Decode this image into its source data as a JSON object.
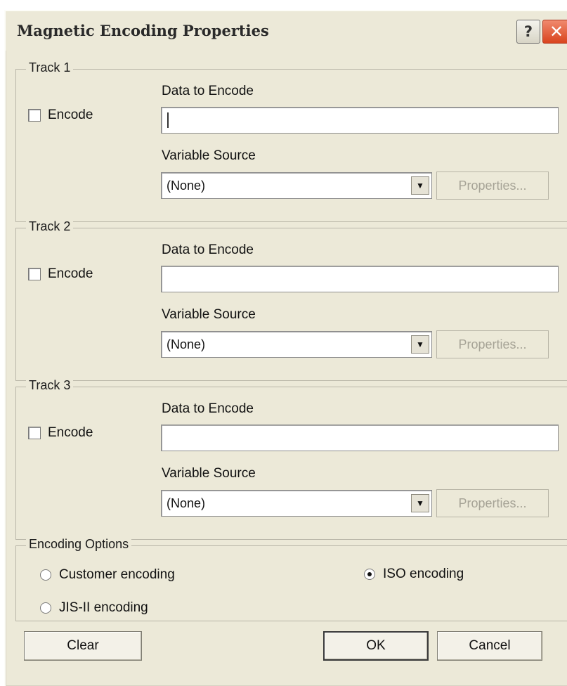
{
  "window": {
    "title": "Magnetic Encoding Properties",
    "help_glyph": "?",
    "close_glyph": "✕"
  },
  "tracks": [
    {
      "legend": "Track 1",
      "encode_label": "Encode",
      "encode_checked": false,
      "data_label": "Data to Encode",
      "data_value": "",
      "source_label": "Variable Source",
      "source_value": "(None)",
      "properties_label": "Properties..."
    },
    {
      "legend": "Track 2",
      "encode_label": "Encode",
      "encode_checked": false,
      "data_label": "Data to Encode",
      "data_value": "",
      "source_label": "Variable Source",
      "source_value": "(None)",
      "properties_label": "Properties..."
    },
    {
      "legend": "Track 3",
      "encode_label": "Encode",
      "encode_checked": false,
      "data_label": "Data to Encode",
      "data_value": "",
      "source_label": "Variable Source",
      "source_value": "(None)",
      "properties_label": "Properties..."
    }
  ],
  "encoding_options": {
    "legend": "Encoding Options",
    "customer": "Customer encoding",
    "iso": "ISO encoding",
    "jis": "JIS-II encoding",
    "selected": "iso"
  },
  "buttons": {
    "clear": "Clear",
    "ok": "OK",
    "cancel": "Cancel"
  },
  "colors": {
    "dialog_bg": "#ece9d8",
    "close_button": "#d9441e"
  },
  "icons": {
    "help": "question-mark-icon",
    "close": "close-icon",
    "dropdown": "chevron-down-icon"
  }
}
